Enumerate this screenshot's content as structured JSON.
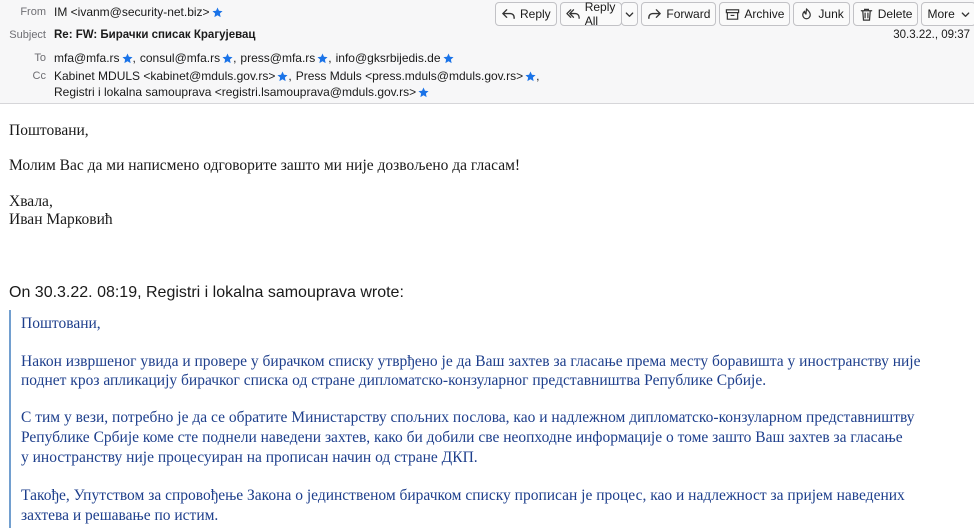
{
  "header": {
    "from_label": "From",
    "from_value": "IM <ivanm@security-net.biz>",
    "subject_label": "Subject",
    "subject_value": "Re: FW: Бирачки списак Крагујевац",
    "to_label": "To",
    "to_recipients": [
      "mfa@mfa.rs",
      "consul@mfa.rs",
      "press@mfa.rs",
      "info@gksrbijedis.de"
    ],
    "cc_label": "Cc",
    "cc_recipients": [
      "Kabinet MDULS <kabinet@mduls.gov.rs>",
      "Press Mduls <press.mduls@mduls.gov.rs>",
      "Registri i lokalna samouprava <registri.lsamouprava@mduls.gov.rs>"
    ],
    "datetime": "30.3.22., 09:37"
  },
  "toolbar": {
    "reply": "Reply",
    "reply_all": "Reply All",
    "forward": "Forward",
    "archive": "Archive",
    "junk": "Junk",
    "delete": "Delete",
    "more": "More"
  },
  "message": {
    "greeting": "Поштовани,",
    "line1": "Молим Вас да ми написмено одговорите зашто ми није дозвољено да гласам!",
    "closing": "Хвала,",
    "signature": "Иван Марковић"
  },
  "quoted": {
    "attribution": "On 30.3.22. 08:19, Registri i lokalna samouprava wrote:",
    "greeting": "Поштовани,",
    "p1_l1": "Након извршеног увида и провере у бирачком списку утврђено је да Ваш захтев за гласање према месту боравишта у иностранству није",
    "p1_l2": "поднет кроз апликацију бирачког списка од стране дипломатско-конзуларног представништва Републике Србије.",
    "p2_l1": "С тим у вези, потребно је да се обратите Министарству спољних послова, као и надлежном дипломатско-конзуларном представништву",
    "p2_l2": "Републике Србије коме сте поднели наведени захтев, како би добили све неопходне информације о томе зашто Ваш захтев за гласање",
    "p2_l3": "у иностранству није процесуиран на прописан начин од стране ДКП.",
    "p3_l1": "Такође, Упутством за спровођење Закона о јединственом бирачком списку прописан је процес, као и надлежност за пријем наведених",
    "p3_l2": "захтева и решавање по истим."
  },
  "colors": {
    "star": "#1a73e8",
    "quote_text": "#1e3f8c",
    "quote_bar": "#729fcf"
  },
  "icons": [
    "reply-icon",
    "reply-all-icon",
    "forward-icon",
    "archive-icon",
    "junk-icon",
    "trash-icon",
    "chevron-down-icon",
    "star-icon"
  ]
}
